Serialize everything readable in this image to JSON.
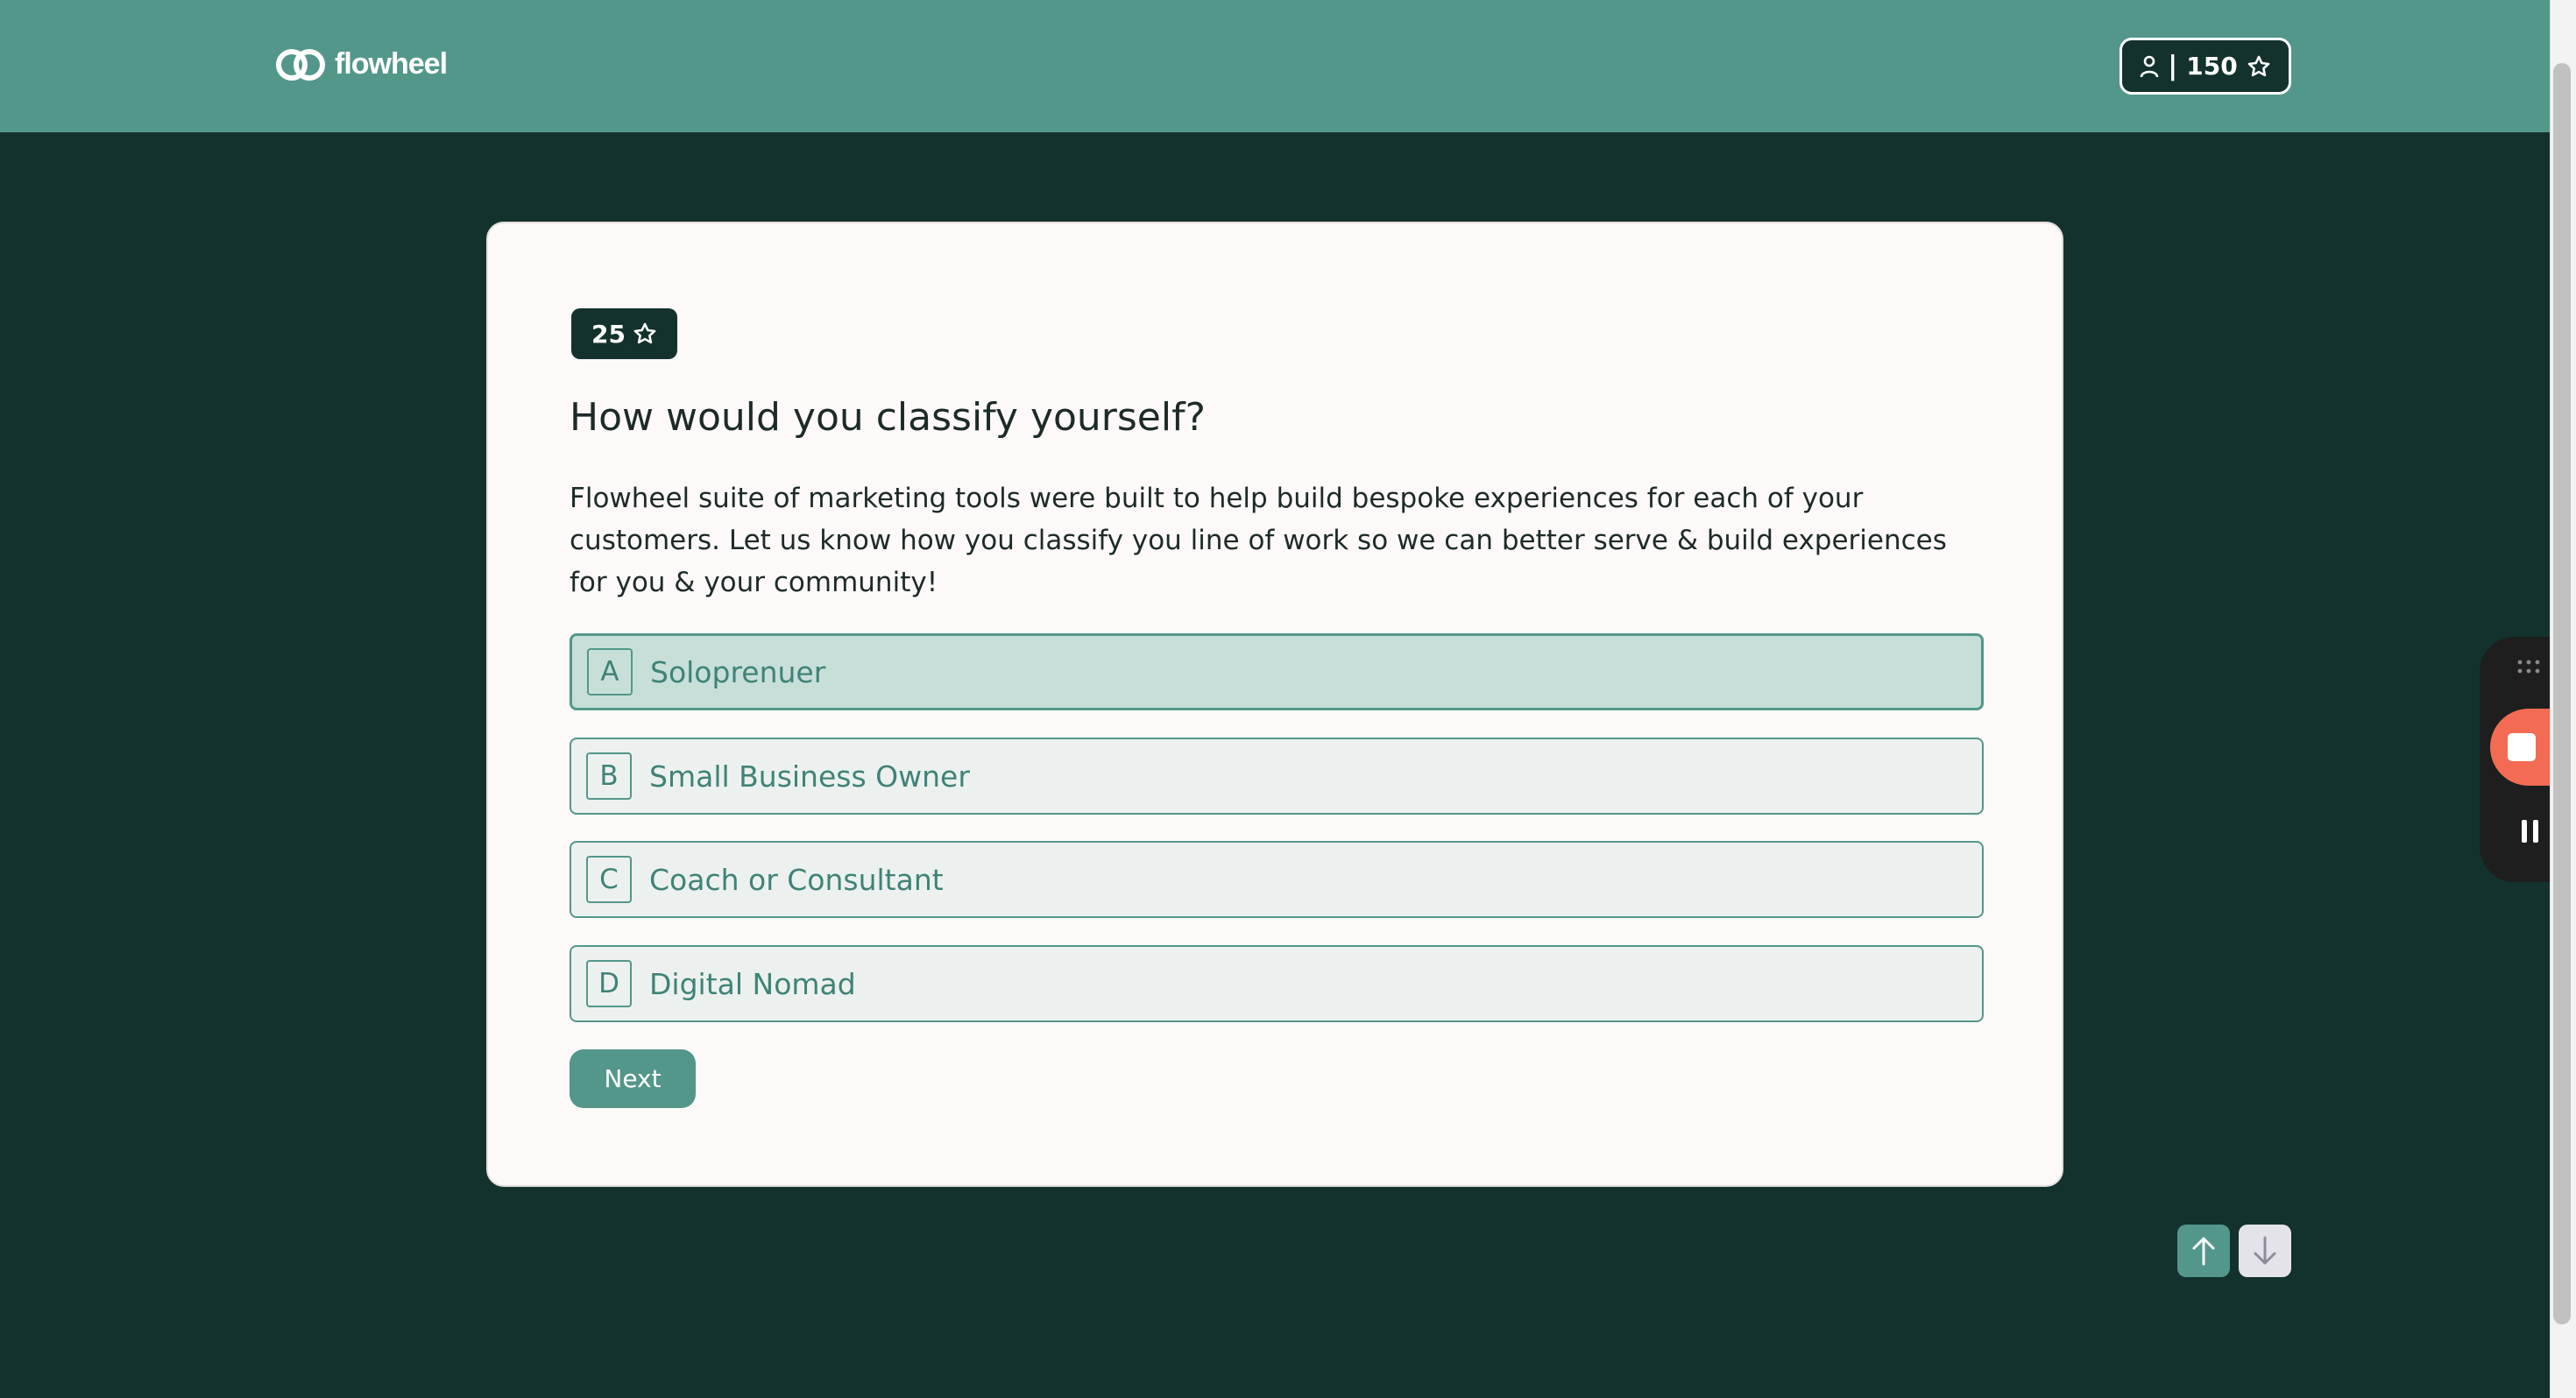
{
  "header": {
    "brand_name": "flowheel",
    "user_points": "150",
    "separator": "|"
  },
  "card": {
    "reward_points": "25",
    "question": "How would you classify yourself?",
    "description": "Flowheel suite of marketing tools were built to help build bespoke experiences for each of your customers. Let us know how you classify you line of work so we can better serve & build experiences for you & your community!",
    "options": [
      {
        "key": "A",
        "label": "Soloprenuer",
        "selected": true
      },
      {
        "key": "B",
        "label": "Small Business Owner",
        "selected": false
      },
      {
        "key": "C",
        "label": "Coach or Consultant",
        "selected": false
      },
      {
        "key": "D",
        "label": "Digital Nomad",
        "selected": false
      }
    ],
    "next_label": "Next"
  },
  "icons": {
    "logo": "flowheel-logo-icon",
    "user": "user-icon",
    "star": "star-icon",
    "up": "arrow-up-icon",
    "down": "arrow-down-icon",
    "grip": "drag-grip-icon",
    "stop": "stop-icon",
    "pause": "pause-icon"
  },
  "colors": {
    "header_bg": "#53978a",
    "page_bg": "#14322d",
    "accent": "#53978a",
    "card_bg": "#fdf9f9",
    "recorder_stop": "#f26b52"
  }
}
